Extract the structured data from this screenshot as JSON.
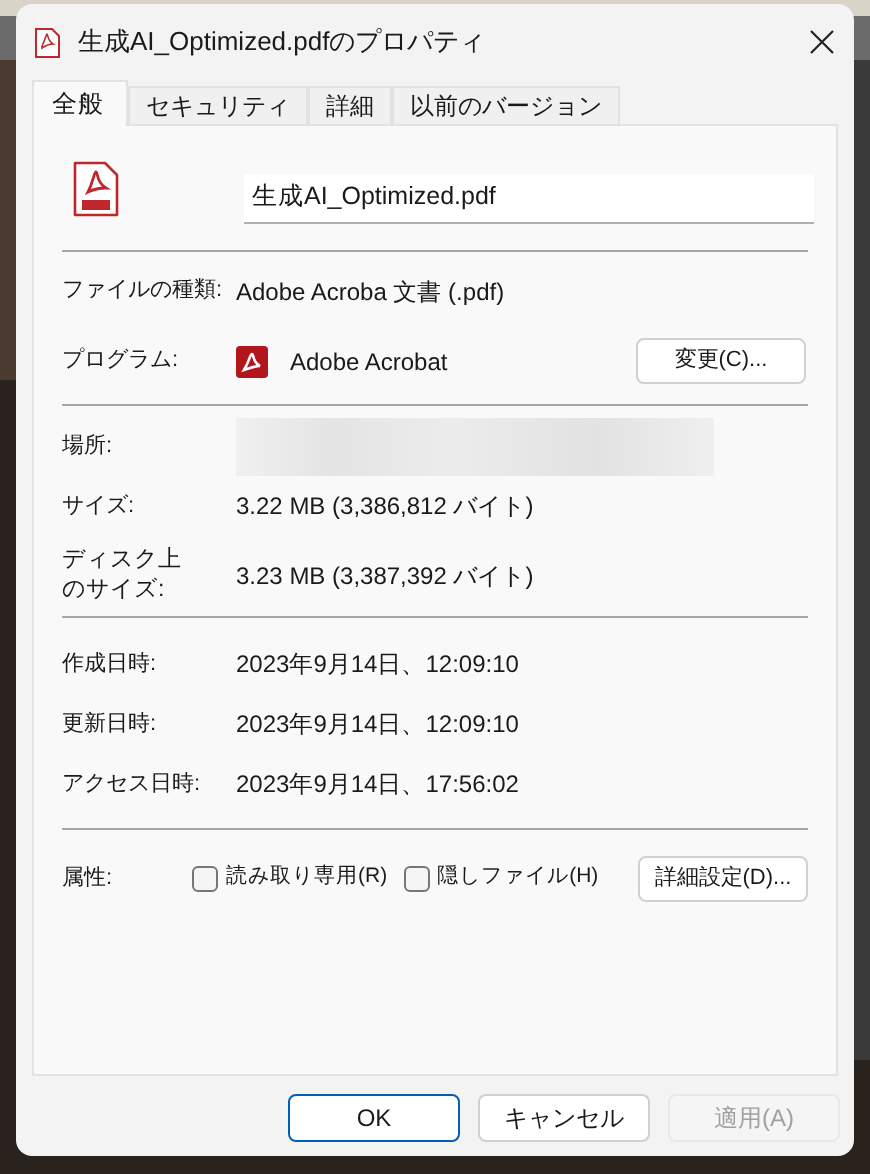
{
  "window": {
    "title": "生成AI_Optimized.pdfのプロパティ"
  },
  "tabs": [
    {
      "label": "全般",
      "selected": true
    },
    {
      "label": "セキュリティ",
      "selected": false
    },
    {
      "label": "詳細",
      "selected": false
    },
    {
      "label": "以前のバージョン",
      "selected": false
    }
  ],
  "file_name": {
    "value": "生成AI_Optimized.pdf"
  },
  "sections": [
    [
      {
        "kind": "text",
        "label": "ファイルの種類:",
        "value": "Adobe Acroba 文書 (.pdf)"
      },
      {
        "kind": "program",
        "label": "プログラム:",
        "value": "Adobe Acrobat",
        "button": "変更(C)..."
      }
    ],
    [
      {
        "kind": "redacted",
        "label": "場所:"
      },
      {
        "kind": "text",
        "label": "サイズ:",
        "value": "3.22 MB (3,386,812 バイト)"
      },
      {
        "kind": "tall",
        "label_lines": [
          "ディスク上",
          "のサイズ:"
        ],
        "value": "3.23 MB (3,387,392 バイト)"
      }
    ],
    [
      {
        "kind": "text",
        "label": "作成日時:",
        "value": "2023年9月14日、12:09:10"
      },
      {
        "kind": "text",
        "label": "更新日時:",
        "value": "2023年9月14日、12:09:10"
      },
      {
        "kind": "text",
        "label": "アクセス日時:",
        "value": "2023年9月14日、17:56:02"
      }
    ]
  ],
  "attributes": {
    "label": "属性:",
    "checkboxes": [
      {
        "label": "読み取り専用(R)",
        "checked": false
      },
      {
        "label": "隠しファイル(H)",
        "checked": false
      }
    ],
    "button": "詳細設定(D)..."
  },
  "buttons": [
    {
      "label": "OK",
      "default": true,
      "disabled": false
    },
    {
      "label": "キャンセル",
      "default": false,
      "disabled": false
    },
    {
      "label": "適用(A)",
      "default": false,
      "disabled": true
    }
  ]
}
